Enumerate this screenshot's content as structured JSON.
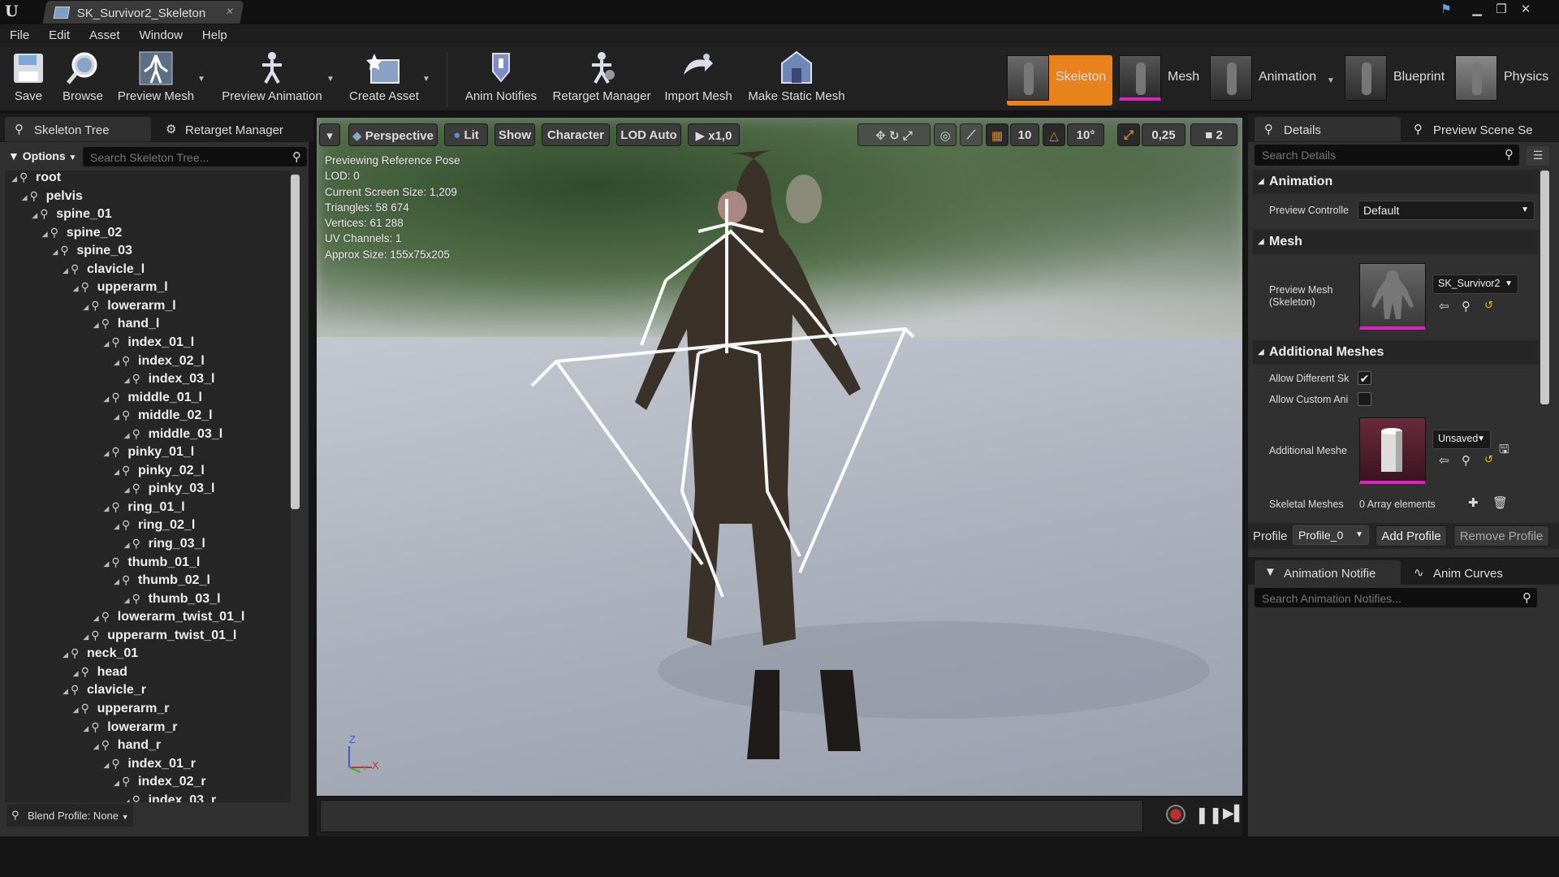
{
  "window": {
    "tab_title": "SK_Survivor2_Skeleton",
    "logo": "U"
  },
  "menu": [
    "File",
    "Edit",
    "Asset",
    "Window",
    "Help"
  ],
  "toolbar": {
    "buttons": [
      {
        "label": "Save",
        "icon": "save-icon"
      },
      {
        "label": "Browse",
        "icon": "browse-icon"
      },
      {
        "label": "Preview Mesh",
        "icon": "preview-mesh-icon"
      },
      {
        "label": "Preview Animation",
        "icon": "preview-animation-icon"
      },
      {
        "label": "Create Asset",
        "icon": "create-asset-icon"
      },
      {
        "label": "Anim Notifies",
        "icon": "anim-notifies-icon"
      },
      {
        "label": "Retarget Manager",
        "icon": "retarget-manager-icon"
      },
      {
        "label": "Import Mesh",
        "icon": "import-mesh-icon"
      },
      {
        "label": "Make Static Mesh",
        "icon": "make-static-mesh-icon"
      }
    ],
    "modes": [
      {
        "label": "Skeleton",
        "active": true
      },
      {
        "label": "Mesh",
        "active": false
      },
      {
        "label": "Animation",
        "active": false
      },
      {
        "label": "Blueprint",
        "active": false
      },
      {
        "label": "Physics",
        "active": false
      }
    ]
  },
  "left": {
    "tabs": [
      "Skeleton Tree",
      "Retarget Manager"
    ],
    "options_label": "Options",
    "search_placeholder": "Search Skeleton Tree...",
    "tree": [
      {
        "name": "root",
        "depth": 0
      },
      {
        "name": "pelvis",
        "depth": 1
      },
      {
        "name": "spine_01",
        "depth": 2
      },
      {
        "name": "spine_02",
        "depth": 3
      },
      {
        "name": "spine_03",
        "depth": 4
      },
      {
        "name": "clavicle_l",
        "depth": 5
      },
      {
        "name": "upperarm_l",
        "depth": 6
      },
      {
        "name": "lowerarm_l",
        "depth": 7
      },
      {
        "name": "hand_l",
        "depth": 8
      },
      {
        "name": "index_01_l",
        "depth": 9
      },
      {
        "name": "index_02_l",
        "depth": 10
      },
      {
        "name": "index_03_l",
        "depth": 11
      },
      {
        "name": "middle_01_l",
        "depth": 9
      },
      {
        "name": "middle_02_l",
        "depth": 10
      },
      {
        "name": "middle_03_l",
        "depth": 11
      },
      {
        "name": "pinky_01_l",
        "depth": 9
      },
      {
        "name": "pinky_02_l",
        "depth": 10
      },
      {
        "name": "pinky_03_l",
        "depth": 11
      },
      {
        "name": "ring_01_l",
        "depth": 9
      },
      {
        "name": "ring_02_l",
        "depth": 10
      },
      {
        "name": "ring_03_l",
        "depth": 11
      },
      {
        "name": "thumb_01_l",
        "depth": 9
      },
      {
        "name": "thumb_02_l",
        "depth": 10
      },
      {
        "name": "thumb_03_l",
        "depth": 11
      },
      {
        "name": "lowerarm_twist_01_l",
        "depth": 8
      },
      {
        "name": "upperarm_twist_01_l",
        "depth": 7
      },
      {
        "name": "neck_01",
        "depth": 5
      },
      {
        "name": "head",
        "depth": 6
      },
      {
        "name": "clavicle_r",
        "depth": 5
      },
      {
        "name": "upperarm_r",
        "depth": 6
      },
      {
        "name": "lowerarm_r",
        "depth": 7
      },
      {
        "name": "hand_r",
        "depth": 8
      },
      {
        "name": "index_01_r",
        "depth": 9
      },
      {
        "name": "index_02_r",
        "depth": 10
      },
      {
        "name": "index_03_r",
        "depth": 11
      }
    ],
    "blend_profile": "Blend Profile: None"
  },
  "viewport": {
    "buttons": {
      "perspective": "Perspective",
      "lit": "Lit",
      "show": "Show",
      "character": "Character",
      "lod": "LOD Auto",
      "speed": "x1,0",
      "grid": "10",
      "angle": "10°",
      "scale": "0,25",
      "cam": "2"
    },
    "stats": [
      "Previewing Reference Pose",
      "LOD: 0",
      "Current Screen Size: 1,209",
      "Triangles: 58 674",
      "Vertices: 61 288",
      "UV Channels: 1",
      "Approx Size: 155x75x205"
    ],
    "axis": {
      "z": "Z",
      "x": "X",
      "y": "Y"
    }
  },
  "right": {
    "tabs": [
      "Details",
      "Preview Scene Se"
    ],
    "search_placeholder": "Search Details",
    "sections": {
      "animation": "Animation",
      "mesh": "Mesh",
      "additional": "Additional Meshes"
    },
    "preview_controller_label": "Preview Controlle",
    "preview_controller_value": "Default",
    "preview_mesh_label": "Preview Mesh\n(Skeleton)",
    "preview_mesh_value": "SK_Survivor2",
    "allow_diff_label": "Allow Different Sk",
    "allow_custom_label": "Allow Custom Ani",
    "allow_diff_checked": true,
    "allow_custom_checked": false,
    "additional_label": "Additional Meshe",
    "additional_value": "Unsaved",
    "skeletal_meshes_label": "Skeletal Meshes",
    "skeletal_meshes_value": "0 Array elements",
    "profile_label": "Profile",
    "profile_value": "Profile_0",
    "add_profile": "Add Profile",
    "remove_profile": "Remove Profile",
    "bottom_tabs": [
      "Animation Notifie",
      "Anim Curves"
    ],
    "notifies_search": "Search Animation Notifies..."
  },
  "colors": {
    "accent": "#e8821c",
    "mesh_pink": "#e020c0",
    "bg": "#303030"
  }
}
